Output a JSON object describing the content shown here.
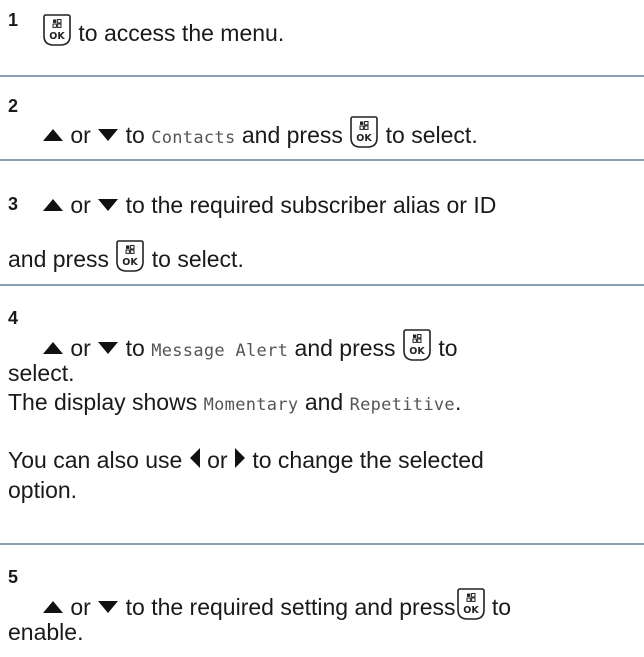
{
  "steps": [
    {
      "number": "1",
      "lines": [
        {
          "icon": "ok-button-icon",
          "text": "to access the menu."
        }
      ]
    },
    {
      "number": "2",
      "or": "or",
      "to": "to",
      "menu_item": "Contacts",
      "and_press": "and press",
      "icon": "ok-button-icon",
      "tail": "to select."
    },
    {
      "number": "3",
      "or": "or",
      "line1_tail": "to the required subscriber alias or ID",
      "line2_head": "and press",
      "icon": "ok-button-icon",
      "line2_tail": "to select."
    },
    {
      "number": "4",
      "or": "or",
      "to": "to",
      "menu_item": "Message Alert",
      "and_press": "and press",
      "icon": "ok-button-icon",
      "tail1": "to",
      "tail2": "select.",
      "display_prefix": "The display shows",
      "option1": "Momentary",
      "and": "and",
      "option2": "Repetitive",
      "period": ".",
      "also_prefix": "You can also use",
      "or2": "or",
      "also_suffix": "to change the selected",
      "also_line2": "option."
    },
    {
      "number": "5",
      "or": "or",
      "mid": "to the required setting and press",
      "icon": "ok-button-icon",
      "tail1": "to",
      "tail2": "enable."
    }
  ],
  "colors": {
    "separator": "#8da0b1",
    "text": "#1a1a1a",
    "mono_text": "#555555"
  }
}
